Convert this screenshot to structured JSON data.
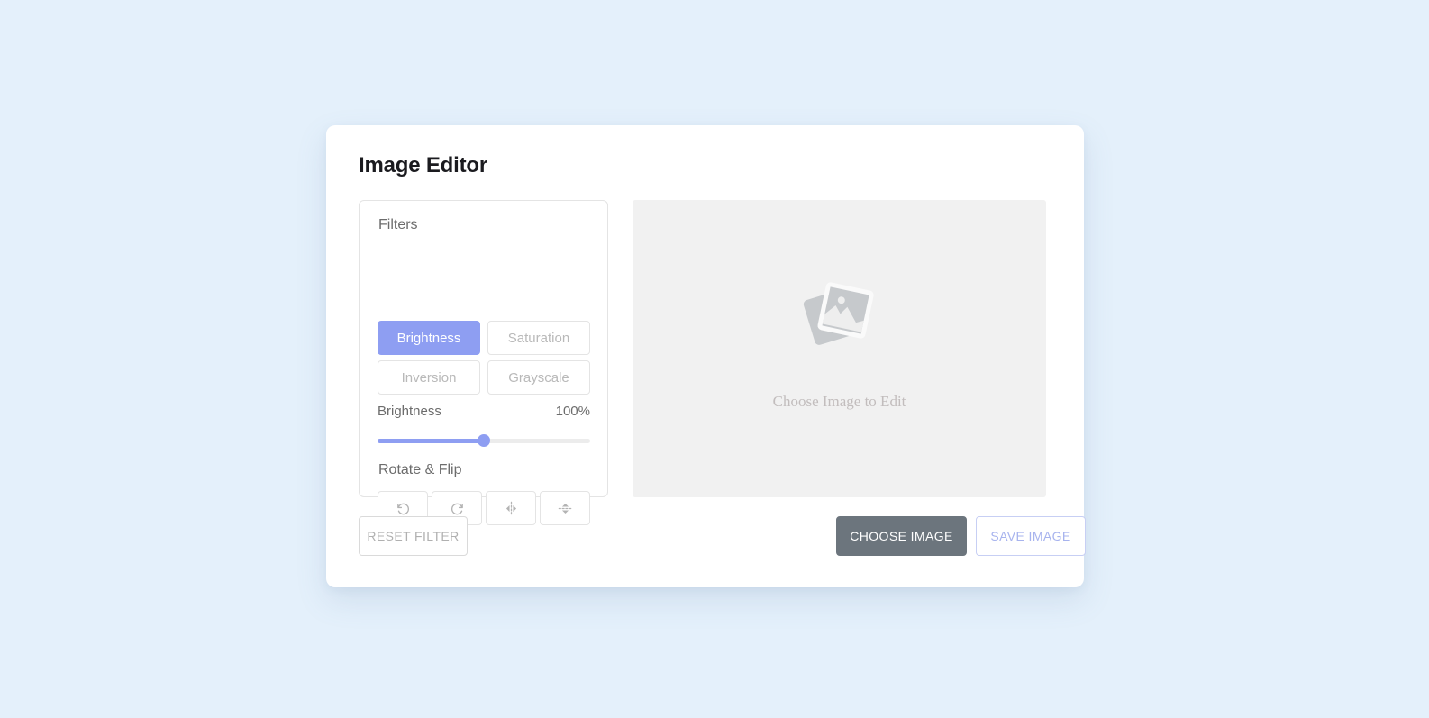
{
  "app": {
    "title": "Image Editor",
    "background_color": "#e4f0fb",
    "accent_color": "#8e9ef2"
  },
  "filters": {
    "heading": "Filters",
    "options": [
      {
        "label": "Brightness",
        "active": true
      },
      {
        "label": "Saturation",
        "active": false
      },
      {
        "label": "Inversion",
        "active": false
      },
      {
        "label": "Grayscale",
        "active": false
      }
    ],
    "slider": {
      "label": "Brightness",
      "value_text": "100%",
      "value": 100,
      "min": 0,
      "max": 200,
      "percent": 50
    }
  },
  "rotate_flip": {
    "heading": "Rotate & Flip",
    "buttons": [
      {
        "name": "rotate-left",
        "icon": "rotate-counterclockwise-icon"
      },
      {
        "name": "rotate-right",
        "icon": "rotate-clockwise-icon"
      },
      {
        "name": "flip-horizontal",
        "icon": "flip-horizontal-icon"
      },
      {
        "name": "flip-vertical",
        "icon": "flip-vertical-icon"
      }
    ]
  },
  "preview": {
    "placeholder_text": "Choose Image to Edit",
    "placeholder_icon": "stacked-photos-icon",
    "background_color": "#f1f1f1"
  },
  "footer": {
    "reset_filter_label": "RESET FILTER",
    "choose_image_label": "CHOOSE IMAGE",
    "save_image_label": "SAVE IMAGE"
  }
}
